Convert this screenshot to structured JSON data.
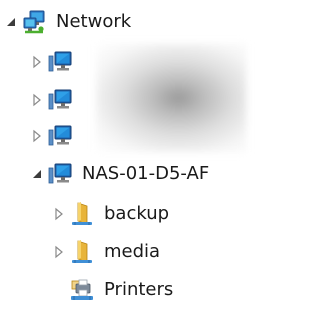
{
  "tree": {
    "root": {
      "label": "Network",
      "icon": "network-icon",
      "expanded": true
    },
    "computers": [
      {
        "label": "",
        "icon": "computer-icon",
        "expanded": false
      },
      {
        "label": "",
        "icon": "computer-icon",
        "expanded": false
      },
      {
        "label": "",
        "icon": "computer-icon",
        "expanded": false
      }
    ],
    "nas": {
      "label": "NAS-01-D5-AF",
      "icon": "computer-icon",
      "expanded": true,
      "children": [
        {
          "label": "backup",
          "icon": "shared-folder-icon",
          "expanded": false
        },
        {
          "label": "media",
          "icon": "shared-folder-icon",
          "expanded": false
        },
        {
          "label": "Printers",
          "icon": "printers-icon"
        }
      ]
    }
  }
}
